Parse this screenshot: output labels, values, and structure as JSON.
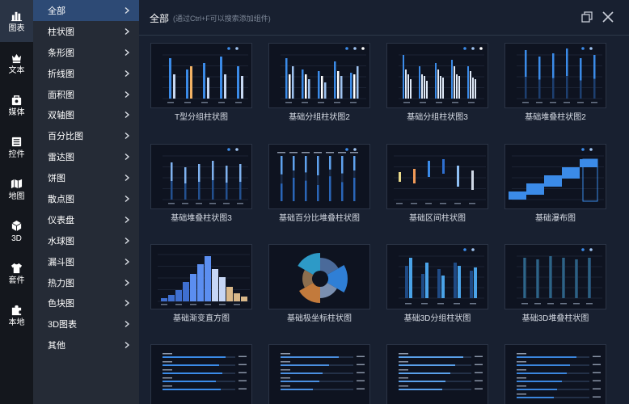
{
  "rail": [
    {
      "label": "图表",
      "icon": "bar-chart-icon",
      "active": true
    },
    {
      "label": "文本",
      "icon": "crown-text-icon",
      "active": false
    },
    {
      "label": "媒体",
      "icon": "media-bag-icon",
      "active": false
    },
    {
      "label": "控件",
      "icon": "control-widget-icon",
      "active": false
    },
    {
      "label": "地图",
      "icon": "map-icon",
      "active": false
    },
    {
      "label": "3D",
      "icon": "cube-3d-icon",
      "active": false
    },
    {
      "label": "套件",
      "icon": "shirt-kit-icon",
      "active": false
    },
    {
      "label": "本地",
      "icon": "puzzle-local-icon",
      "active": false
    }
  ],
  "categories": [
    "全部",
    "柱状图",
    "条形图",
    "折线图",
    "面积图",
    "双轴图",
    "百分比图",
    "雷达图",
    "饼图",
    "散点图",
    "仪表盘",
    "水球图",
    "漏斗图",
    "热力图",
    "色块图",
    "3D图表",
    "其他"
  ],
  "active_category": 0,
  "header": {
    "title": "全部",
    "hint": "(通过Ctrl+F可以搜索添加组件)"
  },
  "cards": [
    {
      "title": "T型分组柱状图",
      "kind": "tgroup"
    },
    {
      "title": "基础分组柱状图2",
      "kind": "group2"
    },
    {
      "title": "基础分组柱状图3",
      "kind": "group3"
    },
    {
      "title": "基础堆叠柱状图2",
      "kind": "stack2"
    },
    {
      "title": "基础堆叠柱状图3",
      "kind": "stack3"
    },
    {
      "title": "基础百分比堆叠柱状图",
      "kind": "percent"
    },
    {
      "title": "基础区间柱状图",
      "kind": "range"
    },
    {
      "title": "基础瀑布图",
      "kind": "waterfall"
    },
    {
      "title": "基础渐变直方图",
      "kind": "histogram"
    },
    {
      "title": "基础极坐标柱状图",
      "kind": "polar"
    },
    {
      "title": "基础3D分组柱状图",
      "kind": "bar3d"
    },
    {
      "title": "基础3D堆叠柱状图",
      "kind": "stack3d"
    },
    {
      "title": "",
      "kind": "hbar1"
    },
    {
      "title": "",
      "kind": "hbar2"
    },
    {
      "title": "",
      "kind": "hbar3"
    },
    {
      "title": "",
      "kind": "hbar4"
    }
  ],
  "colors": {
    "accent": "#3b8be8",
    "light_bar": "#c7d8f2",
    "orange": "#f2b265",
    "active_nav": "#2d4a75"
  }
}
